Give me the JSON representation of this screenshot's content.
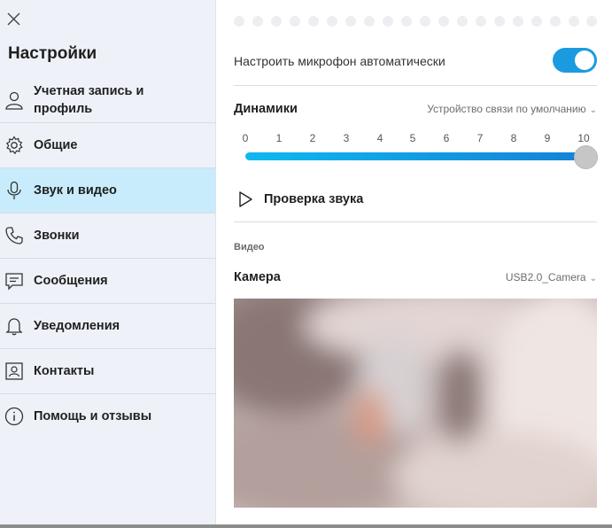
{
  "sidebar": {
    "title": "Настройки",
    "items": [
      {
        "label": "Учетная запись и профиль",
        "icon": "person-icon",
        "active": false
      },
      {
        "label": "Общие",
        "icon": "gear-icon",
        "active": false
      },
      {
        "label": "Звук и видео",
        "icon": "microphone-icon",
        "active": true
      },
      {
        "label": "Звонки",
        "icon": "phone-icon",
        "active": false
      },
      {
        "label": "Сообщения",
        "icon": "chat-icon",
        "active": false
      },
      {
        "label": "Уведомления",
        "icon": "bell-icon",
        "active": false
      },
      {
        "label": "Контакты",
        "icon": "contacts-icon",
        "active": false
      },
      {
        "label": "Помощь и отзывы",
        "icon": "info-icon",
        "active": false
      }
    ]
  },
  "audio": {
    "auto_mic_label": "Настроить микрофон автоматически",
    "auto_mic_on": true,
    "speakers_label": "Динамики",
    "speakers_device": "Устройство связи по умолчанию",
    "volume_ticks": [
      "0",
      "1",
      "2",
      "3",
      "4",
      "5",
      "6",
      "7",
      "8",
      "9",
      "10"
    ],
    "volume_value": 10,
    "test_sound_label": "Проверка звука"
  },
  "video": {
    "section_label": "Видео",
    "camera_label": "Камера",
    "camera_device": "USB2.0_Camera"
  },
  "colors": {
    "accent": "#1b9bdf",
    "active_item": "#c8ecfb",
    "sidebar_bg": "#eef2f8"
  }
}
